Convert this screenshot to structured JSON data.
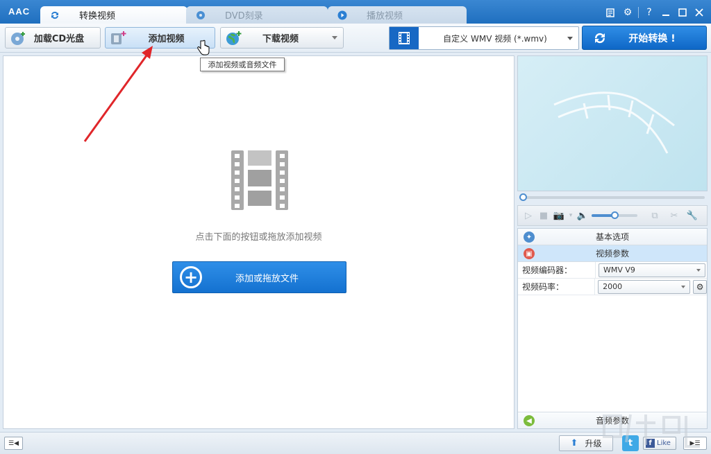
{
  "app": {
    "logo": "AAC"
  },
  "tabs": [
    {
      "label": "转换视频",
      "icon": "convert-icon",
      "active": true
    },
    {
      "label": "DVD刻录",
      "icon": "dvd-icon",
      "active": false
    },
    {
      "label": "播放视频",
      "icon": "play-icon",
      "active": false
    }
  ],
  "toolbar": {
    "load_cd": "加载CD光盘",
    "add_video": "添加视频",
    "download_video": "下载视频",
    "format_selected": "自定义 WMV 视频 (*.wmv)",
    "start": "开始转换 !"
  },
  "tooltip": "添加视频或音频文件",
  "main": {
    "hint": "点击下面的按钮或拖放添加视频",
    "add_button": "添加或拖放文件"
  },
  "settings": {
    "basic_options": "基本选项",
    "video_params": "视频参数",
    "video_encoder_label": "视频编码器：",
    "video_encoder_value": "WMV V9",
    "video_bitrate_label": "视频码率：",
    "video_bitrate_value": "2000",
    "audio_params": "音频参数"
  },
  "statusbar": {
    "upgrade": "升级",
    "like": "Like"
  },
  "colors": {
    "accent": "#1f6fbf",
    "primary_button": "#1471d0",
    "arrow": "#e0262a"
  }
}
